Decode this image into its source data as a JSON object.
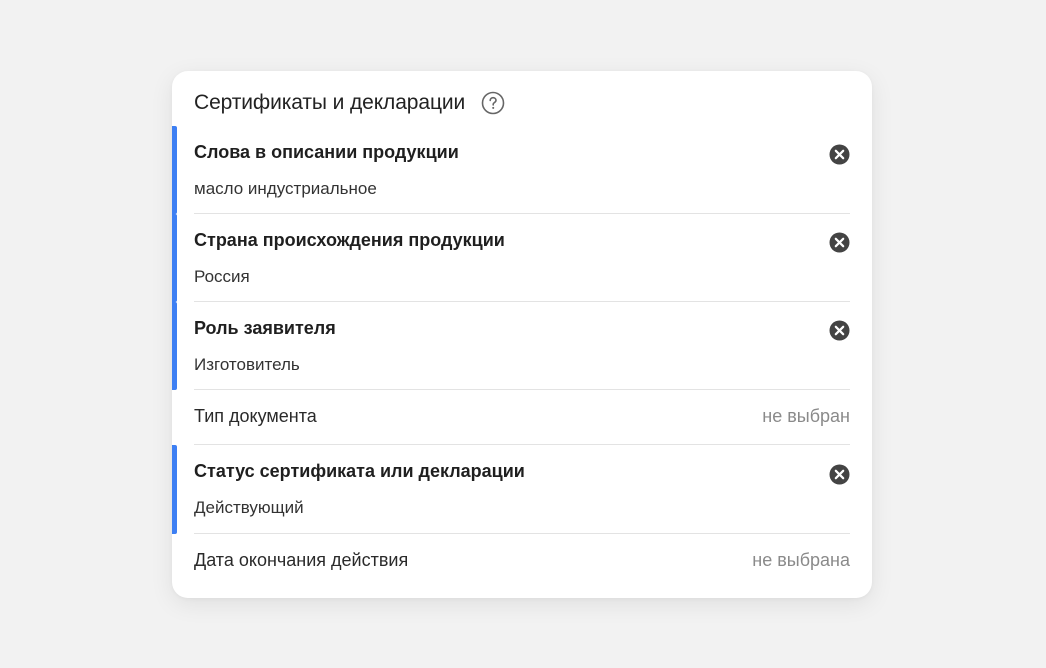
{
  "panel": {
    "title": "Сертификаты и декларации",
    "help_icon": "question-circle-icon"
  },
  "filters": [
    {
      "title": "Слова в описании продукции",
      "value": "масло индустриальное",
      "active": true
    },
    {
      "title": "Страна происхождения продукции",
      "value": "Россия",
      "active": true
    },
    {
      "title": "Роль заявителя",
      "value": "Изготовитель",
      "active": true
    },
    {
      "label": "Тип документа",
      "value": "не выбран",
      "active": false
    },
    {
      "title": "Статус сертификата или декларации",
      "value": "Действующий",
      "active": true
    },
    {
      "label": "Дата окончания действия",
      "value": "не выбрана",
      "active": false
    }
  ],
  "colors": {
    "accent": "#3d7ff3",
    "clear_icon": "#444444",
    "placeholder": "#8a8a8a",
    "background": "#f2f2f2"
  }
}
